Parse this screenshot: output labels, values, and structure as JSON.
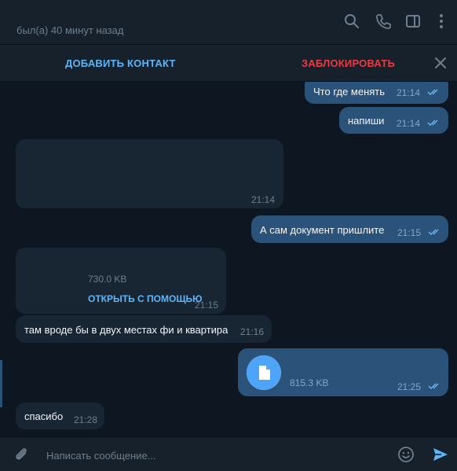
{
  "header": {
    "status": "был(а) 40 минут назад",
    "icons": [
      "search-icon",
      "phone-icon",
      "sidebar-toggle-icon",
      "more-vertical-icon"
    ]
  },
  "action_bar": {
    "add_contact": "ДОБАВИТЬ КОНТАКТ",
    "block": "ЗАБЛОКИРОВАТЬ",
    "close_icon": "close-icon"
  },
  "messages": [
    {
      "direction": "out",
      "text": "Что где менять",
      "time": "21:14",
      "read": true
    },
    {
      "direction": "out",
      "text": "напиши",
      "time": "21:14",
      "read": true
    },
    {
      "direction": "in",
      "text": "",
      "time": "21:14"
    },
    {
      "direction": "out",
      "text": "А сам документ пришлите",
      "time": "21:15",
      "read": true
    },
    {
      "direction": "in",
      "type": "file",
      "size": "730.0 KB",
      "action": "ОТКРЫТЬ С ПОМОЩЬЮ",
      "time": "21:15"
    },
    {
      "direction": "in",
      "text": "там вроде бы в двух местах фи и квартира",
      "time": "21:16"
    },
    {
      "direction": "out",
      "type": "file",
      "size": "815.3 KB",
      "time": "21:25",
      "read": true,
      "icon": "document-icon"
    },
    {
      "direction": "in",
      "text": "спасибо",
      "time": "21:28"
    }
  ],
  "composer": {
    "placeholder": "Написать сообщение...",
    "icons": [
      "attach-icon",
      "emoji-icon",
      "send-icon"
    ]
  },
  "colors": {
    "background": "#0e1621",
    "panel": "#17212b",
    "outgoing_bubble": "#2b5278",
    "incoming_bubble": "#182533",
    "accent": "#5eb5f7",
    "danger": "#ec3942"
  }
}
